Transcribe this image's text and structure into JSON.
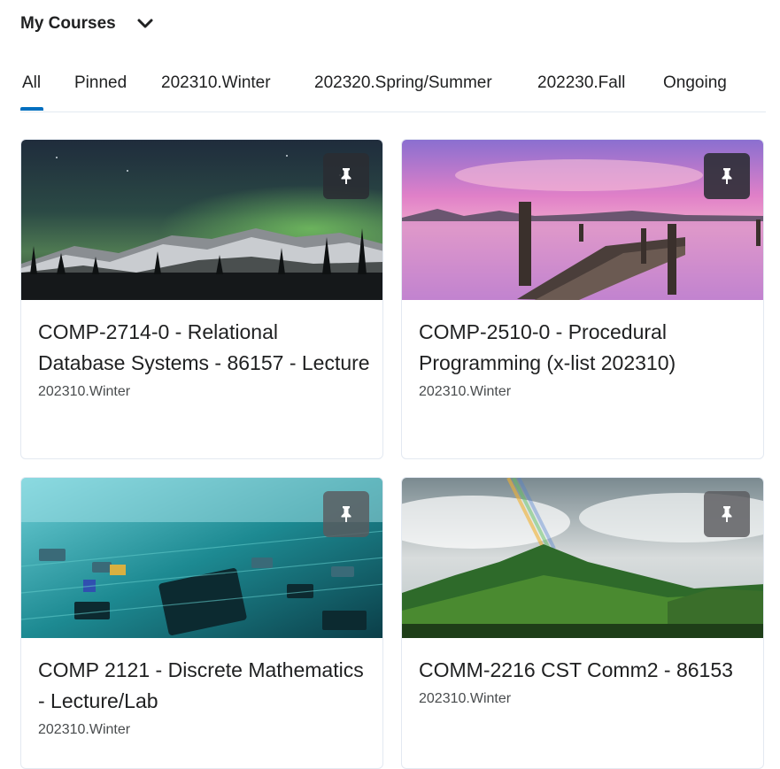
{
  "header": {
    "title": "My Courses",
    "chevron_icon": "chevron-down-icon"
  },
  "tabs": [
    {
      "label": "All",
      "selected": true
    },
    {
      "label": "Pinned",
      "selected": false
    },
    {
      "label": "202310.Winter",
      "selected": false
    },
    {
      "label": "202320.Spring/Summer",
      "selected": false
    },
    {
      "label": "202230.Fall",
      "selected": false
    },
    {
      "label": "Ongoing",
      "selected": false
    }
  ],
  "accent_color": "#006fbf",
  "courses": [
    {
      "title": "COMP-2714-0 - Relational Database Systems - 86157 - Lecture",
      "term": "202310.Winter",
      "image": "aurora-mountains",
      "pin_icon": "pin-icon"
    },
    {
      "title": "COMP-2510-0 - Procedural Programming (x-list 202310)",
      "term": "202310.Winter",
      "image": "pink-lake-pier",
      "pin_icon": "pin-icon"
    },
    {
      "title": "COMP 2121 - Discrete Mathematics - Lecture/Lab",
      "term": "202310.Winter",
      "image": "circuit-board",
      "pin_icon": "pin-icon"
    },
    {
      "title": "COMM-2216 CST Comm2 - 86153",
      "term": "202310.Winter",
      "image": "green-mountain-rainbow",
      "pin_icon": "pin-icon"
    }
  ]
}
